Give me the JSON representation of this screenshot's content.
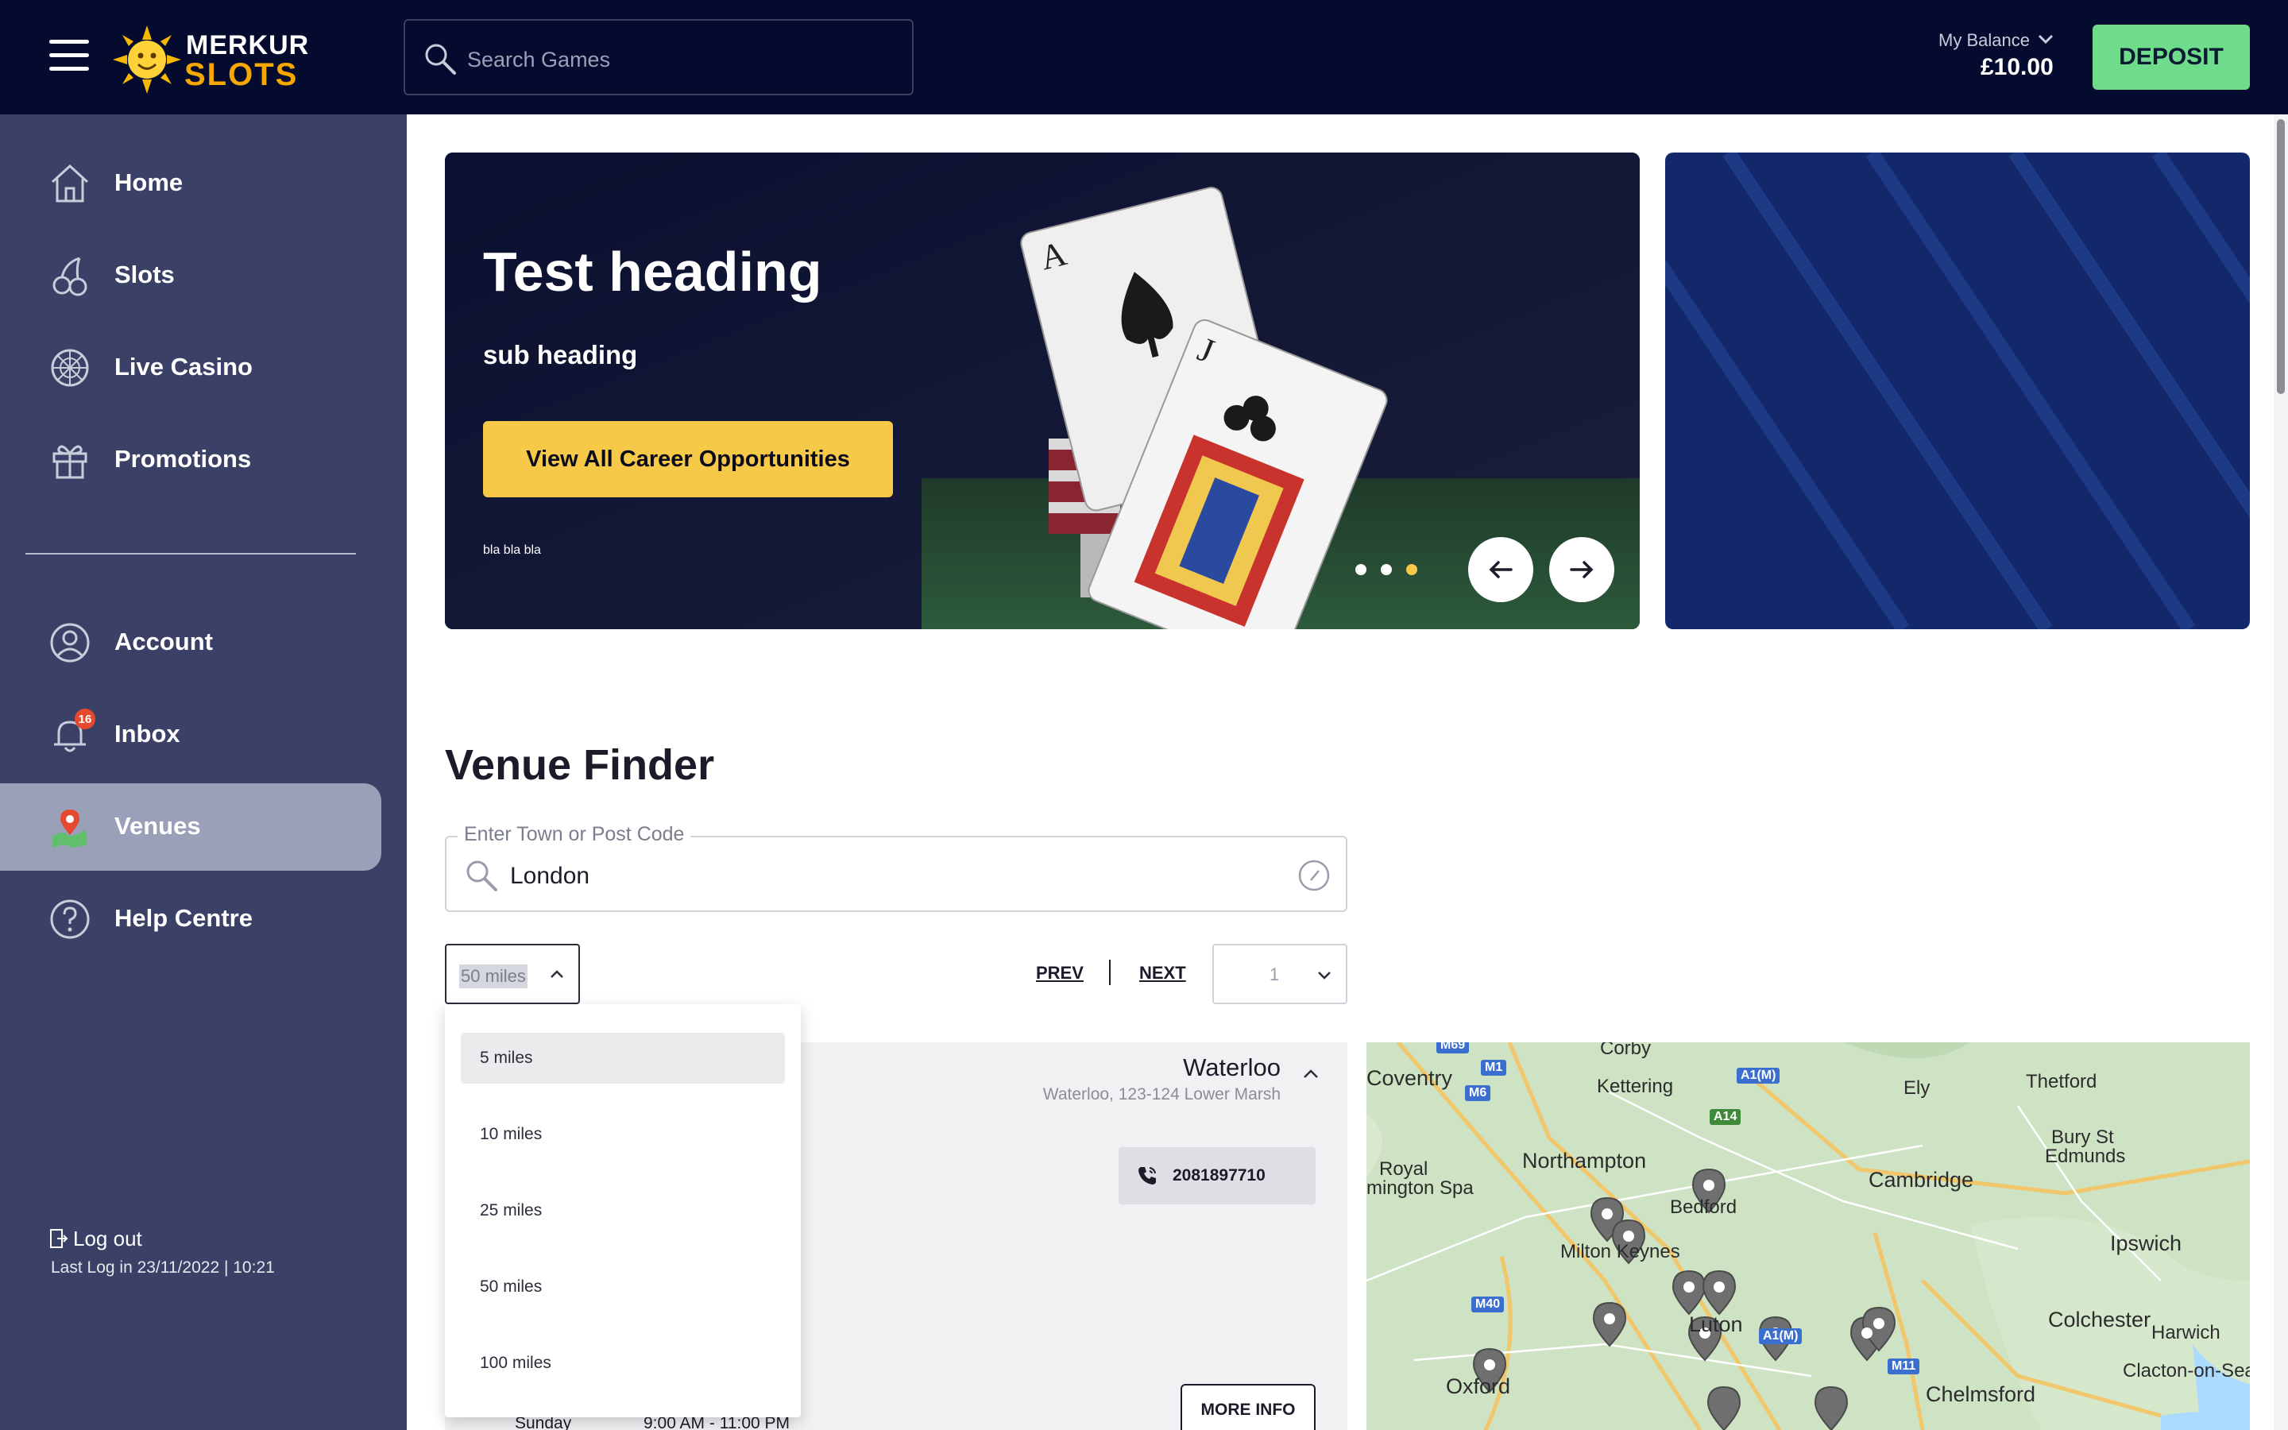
{
  "header": {
    "logo_top": "MERKUR",
    "logo_bottom": "SLOTS",
    "search_placeholder": "Search Games",
    "balance_label": "My Balance",
    "balance_value": "£10.00",
    "deposit_label": "DEPOSIT"
  },
  "sidebar": {
    "items": [
      {
        "label": "Home",
        "icon": "home-icon"
      },
      {
        "label": "Slots",
        "icon": "cherries-icon"
      },
      {
        "label": "Live Casino",
        "icon": "roulette-icon"
      },
      {
        "label": "Promotions",
        "icon": "gift-icon"
      },
      {
        "label": "Account",
        "icon": "user-icon"
      },
      {
        "label": "Inbox",
        "icon": "bell-icon",
        "badge": "16"
      },
      {
        "label": "Venues",
        "icon": "map-pin-icon",
        "active": true
      },
      {
        "label": "Help Centre",
        "icon": "help-icon"
      }
    ],
    "logout_label": "Log out",
    "last_login": "Last Log in 23/11/2022 | 10:21"
  },
  "banner": {
    "heading": "Test heading",
    "subheading": "sub heading",
    "cta_label": "View All Career Opportunities",
    "small_text": "bla bla bla",
    "slide_count": 3,
    "active_slide": 3
  },
  "venue_finder": {
    "title": "Venue Finder",
    "town_label": "Enter Town or Post Code",
    "town_value": "London",
    "radius_selected": "50 miles",
    "radius_options": [
      "5 miles",
      "10 miles",
      "25 miles",
      "50 miles",
      "100 miles"
    ],
    "pager_prev": "PREV",
    "pager_next": "NEXT",
    "page_selected": "1",
    "venue": {
      "name": "Waterloo",
      "address": "Waterloo, 123-124 Lower Marsh",
      "phone": "2081897710",
      "hours_day": "Sunday",
      "hours_time": "9:00 AM - 11:00 PM",
      "more_info_label": "MORE INFO"
    }
  },
  "map": {
    "places": [
      "Coventry",
      "Corby",
      "Kettering",
      "Thetford",
      "Ely",
      "Royal",
      "mington Spa",
      "Northampton",
      "Cambridge",
      "Bury St",
      "Edmunds",
      "Bedford",
      "Ipswich",
      "Milton Keynes",
      "Colchester",
      "Harwich",
      "Luton",
      "Clacton-on-Sea",
      "Oxford",
      "Chelmsford"
    ],
    "roads": [
      "M69",
      "M1",
      "M6",
      "A1(M)",
      "A14",
      "M40",
      "A1(M)",
      "M11"
    ]
  },
  "colors": {
    "topbar": "#050b2e",
    "sidebar": "#3b4166",
    "deposit": "#6fdc8c",
    "cta": "#f7c948",
    "accent_banner": "#12286b"
  }
}
